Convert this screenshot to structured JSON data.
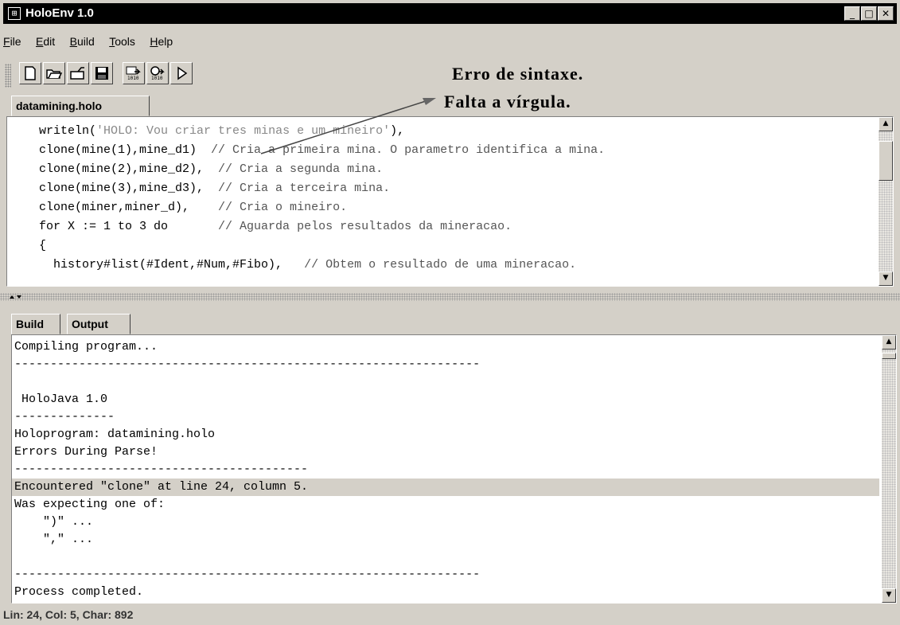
{
  "window": {
    "title": "HoloEnv 1.0",
    "app_icon": "⊞",
    "minimize": "_",
    "maximize": "□",
    "close": "✕"
  },
  "menu": [
    "File",
    "Edit",
    "Build",
    "Tools",
    "Help"
  ],
  "toolbar": {
    "icons": [
      "new-file-icon",
      "open-folder-icon",
      "open-project-icon",
      "save-icon",
      "compile-icon",
      "build-icon",
      "run-icon"
    ]
  },
  "annotation": {
    "line1": "Erro de sintaxe.",
    "line2": "Falta a vírgula."
  },
  "editor_tab": "datamining.holo",
  "editor_lines": [
    {
      "code": "    writeln(",
      "str": "'HOLO: Vou criar tres minas e um mineiro'",
      "code2": "),",
      "comment": ""
    },
    {
      "code": "    clone(mine(1),mine_d1)  ",
      "str": "",
      "code2": "",
      "comment": "// Cria a primeira mina. O parametro identifica a mina."
    },
    {
      "code": "    clone(mine(2),mine_d2),  ",
      "str": "",
      "code2": "",
      "comment": "// Cria a segunda mina."
    },
    {
      "code": "    clone(mine(3),mine_d3),  ",
      "str": "",
      "code2": "",
      "comment": "// Cria a terceira mina."
    },
    {
      "code": "    clone(miner,miner_d),    ",
      "str": "",
      "code2": "",
      "comment": "// Cria o mineiro."
    },
    {
      "code": "    for X := 1 to 3 do       ",
      "str": "",
      "code2": "",
      "comment": "// Aguarda pelos resultados da mineracao."
    },
    {
      "code": "    {",
      "str": "",
      "code2": "",
      "comment": ""
    },
    {
      "code": "      history#list(#Ident,#Num,#Fibo),   ",
      "str": "",
      "code2": "",
      "comment": "// Obtem o resultado de uma mineracao."
    }
  ],
  "bottom_tabs": [
    "Build",
    "Output"
  ],
  "output_lines": [
    "Compiling program...",
    "-----------------------------------------------------------------",
    "",
    " HoloJava 1.0",
    "--------------",
    "Holoprogram: datamining.holo",
    "Errors During Parse!",
    "-----------------------------------------",
    "Encountered \"clone\" at line 24, column 5.",
    "Was expecting one of:",
    "    \")\" ...",
    "    \",\" ...",
    "",
    "-----------------------------------------------------------------",
    "Process completed."
  ],
  "highlight_output_line": 8,
  "status": "Lin: 24, Col: 5, Char: 892"
}
